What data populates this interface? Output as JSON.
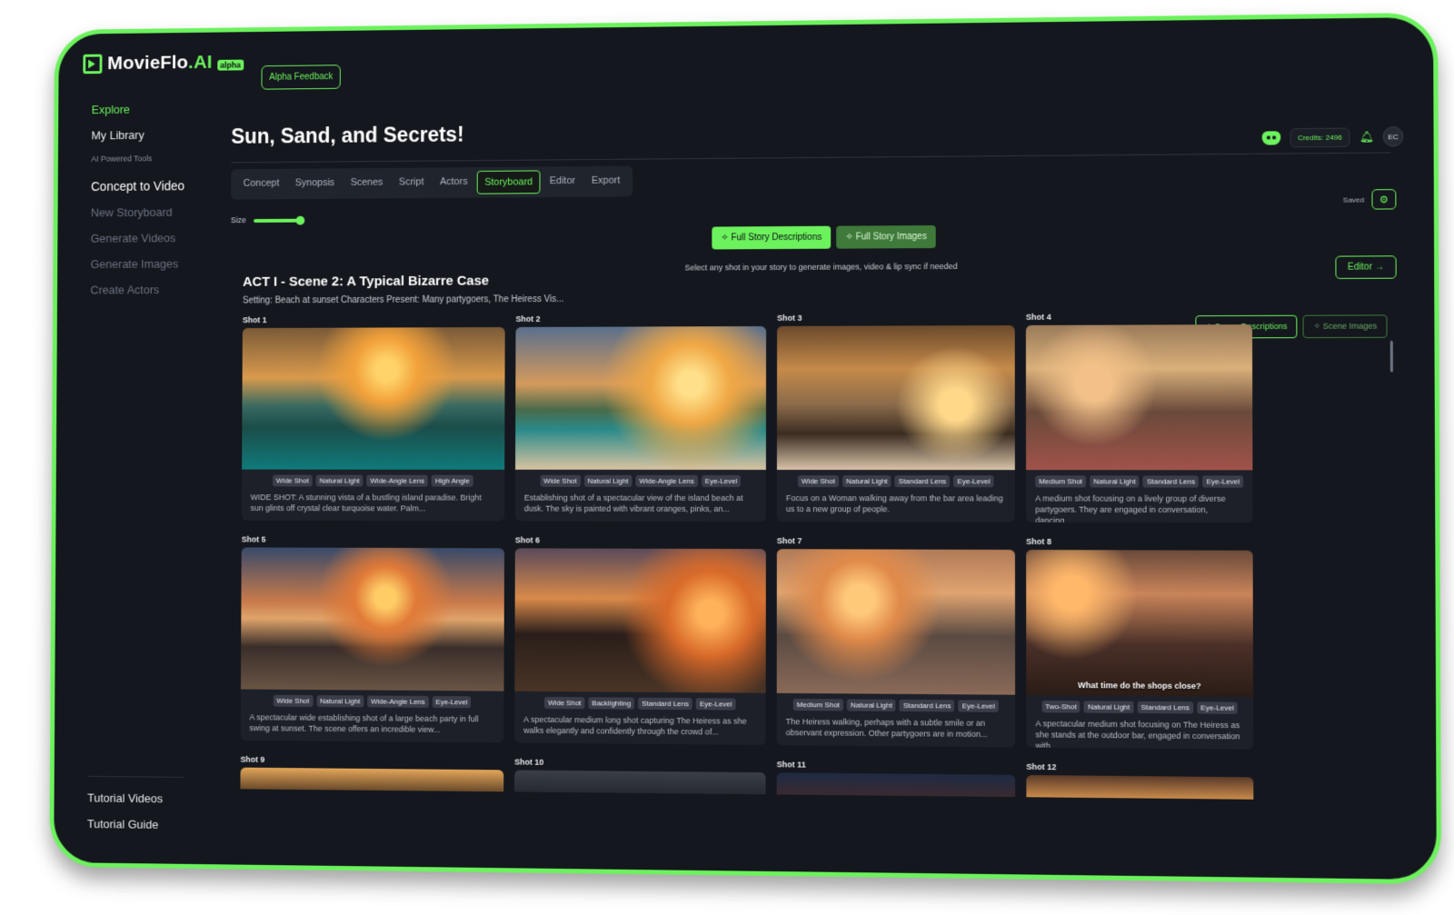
{
  "brand": {
    "name": "MovieFlo",
    "suffix": ".AI",
    "badge": "alpha"
  },
  "alpha_feedback": "Alpha Feedback",
  "sidebar": {
    "items": [
      {
        "label": "Explore",
        "state": "active"
      },
      {
        "label": "My Library",
        "state": "normal"
      }
    ],
    "section_label": "AI Powered Tools",
    "tools": [
      {
        "label": "Concept to Video",
        "state": "strong"
      },
      {
        "label": "New Storyboard",
        "state": "dim"
      },
      {
        "label": "Generate Videos",
        "state": "dim"
      },
      {
        "label": "Generate Images",
        "state": "dim"
      },
      {
        "label": "Create Actors",
        "state": "dim"
      }
    ],
    "bottom": [
      "Tutorial Videos",
      "Tutorial Guide"
    ]
  },
  "header": {
    "title": "Sun, Sand, and Secrets!",
    "credits": "Credits: 2496",
    "avatar": "EC",
    "saved": "Saved",
    "icons": [
      "discord-icon",
      "bell-icon",
      "gear-icon"
    ]
  },
  "tabs": [
    "Concept",
    "Synopsis",
    "Scenes",
    "Script",
    "Actors",
    "Storyboard",
    "Editor",
    "Export"
  ],
  "active_tab": "Storyboard",
  "size_label": "Size",
  "size_value": 1.0,
  "story_buttons": {
    "descriptions": "Full Story Descriptions",
    "images": "Full Story Images"
  },
  "hint": "Select any shot in your story to generate images, video & lip sync if needed",
  "editor_button": "Editor →",
  "scene": {
    "title": "ACT I - Scene 2: A Typical Bizarre Case",
    "setting": "Setting: Beach at sunset Characters Present: Many partygoers, The Heiress Vis...",
    "descriptions_button": "Scene Descriptions",
    "images_button": "Scene Images"
  },
  "shots": [
    {
      "label": "Shot 1",
      "tags": [
        "Wide Shot",
        "Natural Light",
        "Wide-Angle Lens",
        "High Angle"
      ],
      "desc": "WIDE SHOT: A stunning vista of a bustling island paradise. Bright sun glints off crystal clear turquoise water. Palm...",
      "caption": ""
    },
    {
      "label": "Shot 2",
      "tags": [
        "Wide Shot",
        "Natural Light",
        "Wide-Angle Lens",
        "Eye-Level"
      ],
      "desc": "Establishing shot of a spectacular view of the island beach at dusk. The sky is painted with vibrant oranges, pinks, an...",
      "caption": ""
    },
    {
      "label": "Shot 3",
      "tags": [
        "Wide Shot",
        "Natural Light",
        "Standard Lens",
        "Eye-Level"
      ],
      "desc": "Focus on a Woman walking away from the bar area leading us to a new group of people.",
      "caption": ""
    },
    {
      "label": "Shot 4",
      "tags": [
        "Medium Shot",
        "Natural Light",
        "Standard Lens",
        "Eye-Level"
      ],
      "desc": "A medium shot focusing on a lively group of diverse partygoers. They are engaged in conversation, dancing,...",
      "caption": ""
    },
    {
      "label": "Shot 5",
      "tags": [
        "Wide Shot",
        "Natural Light",
        "Wide-Angle Lens",
        "Eye-Level"
      ],
      "desc": "A spectacular wide establishing shot of a large beach party in full swing at sunset. The scene offers an incredible view...",
      "caption": ""
    },
    {
      "label": "Shot 6",
      "tags": [
        "Wide Shot",
        "Backlighting",
        "Standard Lens",
        "Eye-Level"
      ],
      "desc": "A spectacular medium long shot capturing The Heiress as she walks elegantly and confidently through the crowd of...",
      "caption": ""
    },
    {
      "label": "Shot 7",
      "tags": [
        "Medium Shot",
        "Natural Light",
        "Standard Lens",
        "Eye-Level"
      ],
      "desc": "The Heiress walking, perhaps with a subtle smile or an observant expression. Other partygoers are in motion...",
      "caption": ""
    },
    {
      "label": "Shot 8",
      "tags": [
        "Two-Shot",
        "Natural Light",
        "Standard Lens",
        "Eye-Level"
      ],
      "desc": "A spectacular medium shot focusing on The Heiress as she stands at the outdoor bar, engaged in conversation with...",
      "caption": "What time do the shops close?"
    },
    {
      "label": "Shot 9",
      "tags": [],
      "desc": "",
      "caption": ""
    },
    {
      "label": "Shot 10",
      "tags": [],
      "desc": "",
      "caption": ""
    },
    {
      "label": "Shot 11",
      "tags": [],
      "desc": "",
      "caption": ""
    },
    {
      "label": "Shot 12",
      "tags": [],
      "desc": "",
      "caption": ""
    }
  ],
  "colors": {
    "accent": "#6cf25d",
    "background": "#14171d",
    "card": "#1d2028"
  }
}
